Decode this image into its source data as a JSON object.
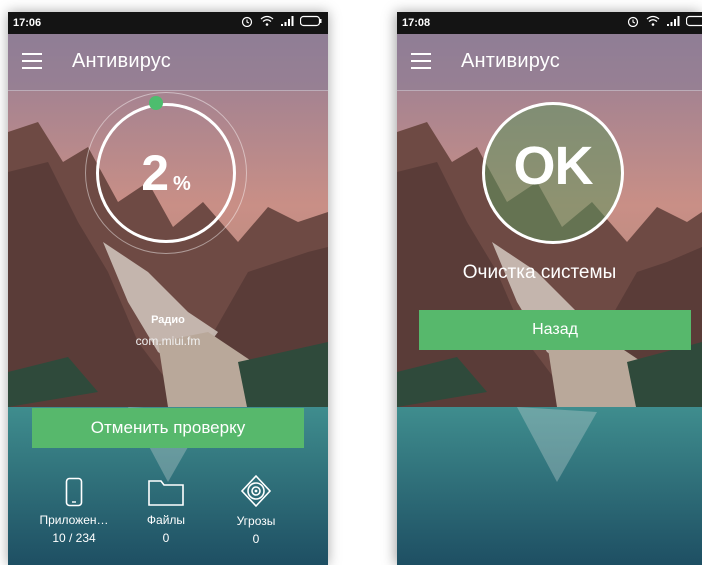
{
  "left_screen": {
    "status_time": "17:06",
    "app_title": "Антивирус",
    "progress_percent": 2,
    "progress_value": "2",
    "progress_unit": "%",
    "current_app_name": "Радио",
    "current_app_package": "com.miui.fm",
    "cancel_button_label": "Отменить проверку",
    "stats": [
      {
        "icon": "phone-icon",
        "label": "Приложен…",
        "value": "10 / 234"
      },
      {
        "icon": "folder-icon",
        "label": "Файлы",
        "value": "0"
      },
      {
        "icon": "threat-target-icon",
        "label": "Угрозы",
        "value": "0"
      }
    ]
  },
  "right_screen": {
    "status_time": "17:08",
    "app_title": "Антивирус",
    "result_text": "OK",
    "status_message": "Очистка системы",
    "back_button_label": "Назад"
  },
  "colors": {
    "accent_green": "#57b86c",
    "status_bar": "#141414",
    "progress_dot": "#4dbd6e"
  }
}
